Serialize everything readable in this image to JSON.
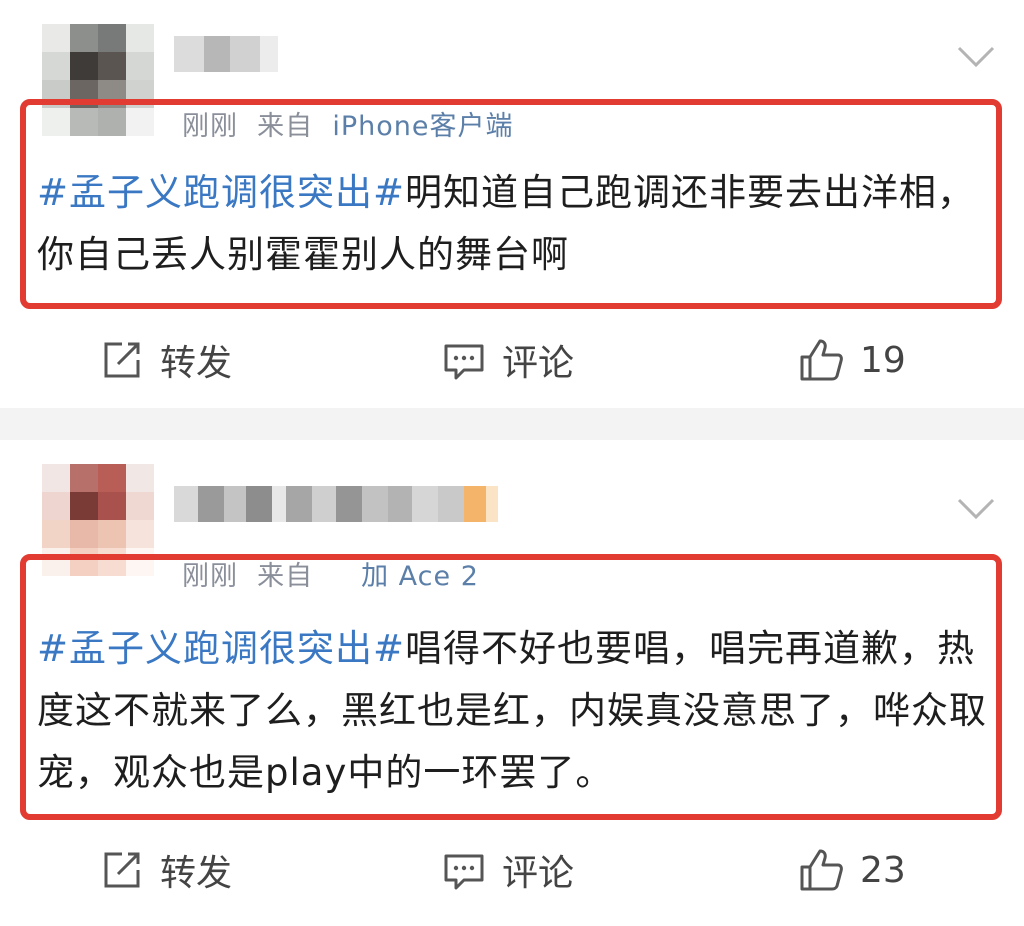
{
  "posts": [
    {
      "meta": {
        "time": "刚刚",
        "from_label": "来自",
        "source": "iPhone客户端"
      },
      "hashtag": "#孟子义跑调很突出#",
      "text": "明知道自己跑调还非要去出洋相，你自己丢人别霍霍别人的舞台啊",
      "actions": {
        "repost": "转发",
        "comment": "评论",
        "likes": "19"
      }
    },
    {
      "meta": {
        "time": "刚刚",
        "from_label": "来自",
        "source": "加 Ace 2"
      },
      "hashtag": "#孟子义跑调很突出#",
      "text": "唱得不好也要唱，唱完再道歉，热度这不就来了么，黑红也是红，内娱真没意思了，哗众取宠，观众也是play中的一环罢了。",
      "actions": {
        "repost": "转发",
        "comment": "评论",
        "likes": "23"
      }
    }
  ],
  "icons": {
    "repost": "repost-icon",
    "comment": "comment-icon",
    "like": "thumbs-up-icon",
    "more": "chevron-down-icon"
  },
  "colors": {
    "highlight_border": "#e23b32",
    "hashtag": "#3a78c3",
    "text": "#1e1e1e",
    "meta": "#8a8f9a"
  }
}
